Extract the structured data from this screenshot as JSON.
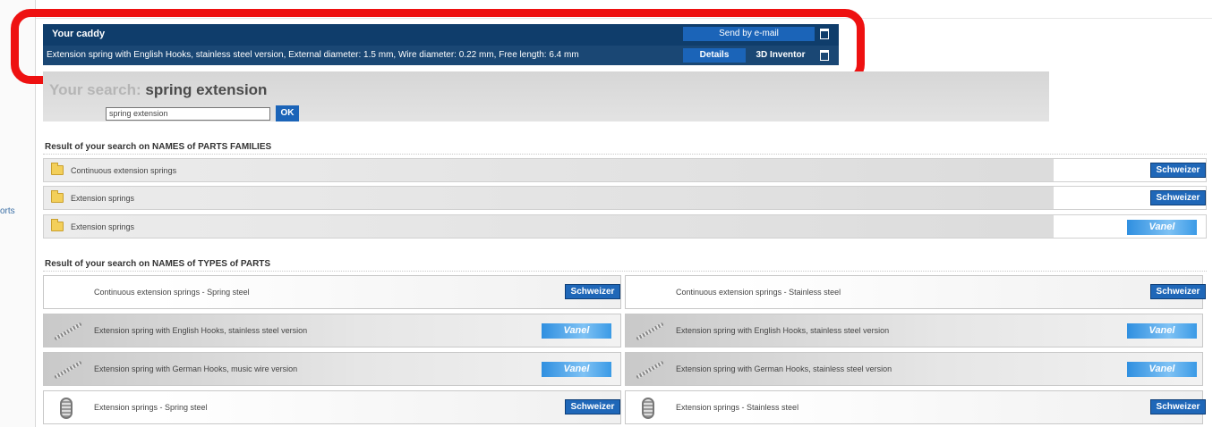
{
  "sidebar": {
    "partial_link": "orts"
  },
  "caddy": {
    "title": "Your caddy",
    "email_button": "Send by e-mail",
    "item_description": "Extension spring with English Hooks, stainless steel version, External diameter: 1.5 mm, Wire diameter: 0.22 mm, Free length: 6.4 mm",
    "details_button": "Details",
    "inventor_button": "3D Inventor",
    "highlight_color": "#ee1111"
  },
  "search": {
    "label": "Your search:",
    "term": "spring extension",
    "input_value": "spring extension",
    "ok_button": "OK"
  },
  "families_section": {
    "title": "Result of your search on NAMES of PARTS FAMILIES",
    "rows": [
      {
        "label": "Continuous extension springs",
        "brand": "Schweizer"
      },
      {
        "label": "Extension springs",
        "brand": "Schweizer"
      },
      {
        "label": "Extension springs",
        "brand": "Vanel"
      }
    ]
  },
  "types_section": {
    "title": "Result of your search on NAMES of TYPES of PARTS",
    "cards": [
      {
        "label": "Continuous extension springs - Spring steel",
        "brand": "Schweizer",
        "thumb": "none"
      },
      {
        "label": "Continuous extension springs - Stainless steel",
        "brand": "Schweizer",
        "thumb": "none"
      },
      {
        "label": "Extension spring with English Hooks, stainless steel version",
        "brand": "Vanel",
        "thumb": "spring-diagonal-icon"
      },
      {
        "label": "Extension spring with English Hooks, stainless steel version",
        "brand": "Vanel",
        "thumb": "spring-diagonal-icon"
      },
      {
        "label": "Extension spring with German Hooks, music wire version",
        "brand": "Vanel",
        "thumb": "spring-diagonal-icon"
      },
      {
        "label": "Extension spring with German Hooks, stainless steel version",
        "brand": "Vanel",
        "thumb": "spring-diagonal-icon"
      },
      {
        "label": "Extension springs - Spring steel",
        "brand": "Schweizer",
        "thumb": "spring-coil-icon"
      },
      {
        "label": "Extension springs - Stainless steel",
        "brand": "Schweizer",
        "thumb": "spring-coil-icon"
      }
    ]
  },
  "colors": {
    "caddy_bg": "#0f3d6b",
    "button_blue": "#1b64b8",
    "vanel_blue": "#2f8fe0"
  }
}
